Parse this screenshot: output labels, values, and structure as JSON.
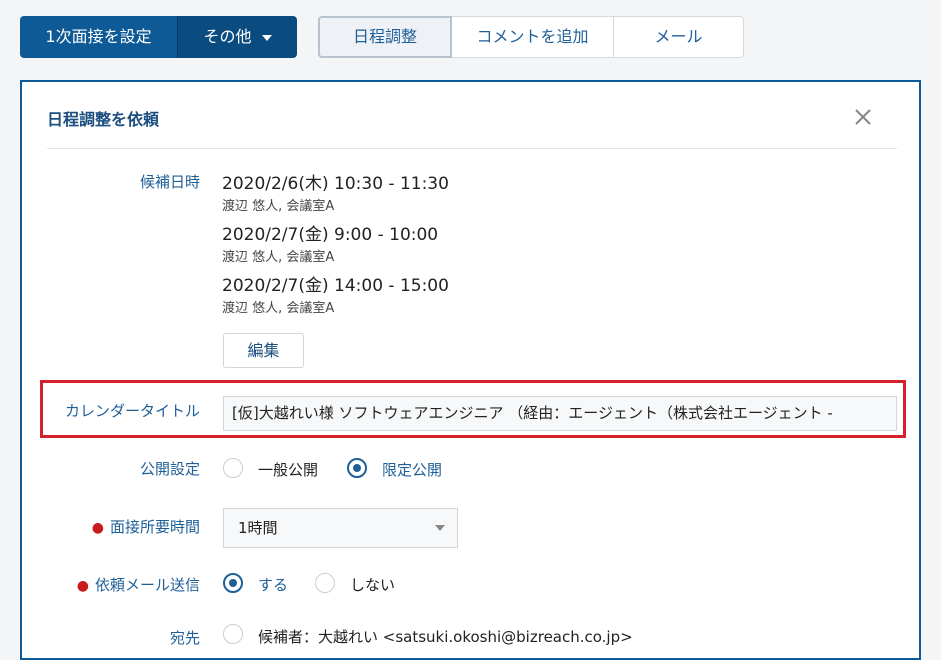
{
  "toolbar": {
    "primary_button": "1次面接を設定",
    "more_button": "その他",
    "tabs": [
      {
        "label": "日程調整",
        "active": true
      },
      {
        "label": "コメントを追加",
        "active": false
      },
      {
        "label": "メール",
        "active": false
      }
    ]
  },
  "panel": {
    "title": "日程調整を依頼",
    "candidates_label": "候補日時",
    "candidates": [
      {
        "time": "2020/2/6(木) 10:30 - 11:30",
        "detail": "渡辺 悠人, 会議室A"
      },
      {
        "time": "2020/2/7(金) 9:00 - 10:00",
        "detail": "渡辺 悠人, 会議室A"
      },
      {
        "time": "2020/2/7(金) 14:00 - 15:00",
        "detail": "渡辺 悠人, 会議室A"
      }
    ],
    "edit_button": "編集",
    "calendar_title_label": "カレンダータイトル",
    "calendar_title_value": "[仮]大越れい様 ソフトウェアエンジニア （経由：エージェント（株式会社エージェント -",
    "visibility_label": "公開設定",
    "visibility_options": [
      "一般公開",
      "限定公開"
    ],
    "visibility_selected": "限定公開",
    "duration_label": "面接所要時間",
    "duration_value": "1時間",
    "send_mail_label": "依頼メール送信",
    "send_mail_options": [
      "する",
      "しない"
    ],
    "send_mail_selected": "する",
    "recipient_label": "宛先",
    "recipient_value": "候補者：大越れい <satsuki.okoshi@bizreach.co.jp>"
  },
  "colors": {
    "brand_blue": "#0e5a96",
    "link_blue": "#1f5f98",
    "required_red": "#c81c1c",
    "highlight_red": "#d6212d"
  }
}
